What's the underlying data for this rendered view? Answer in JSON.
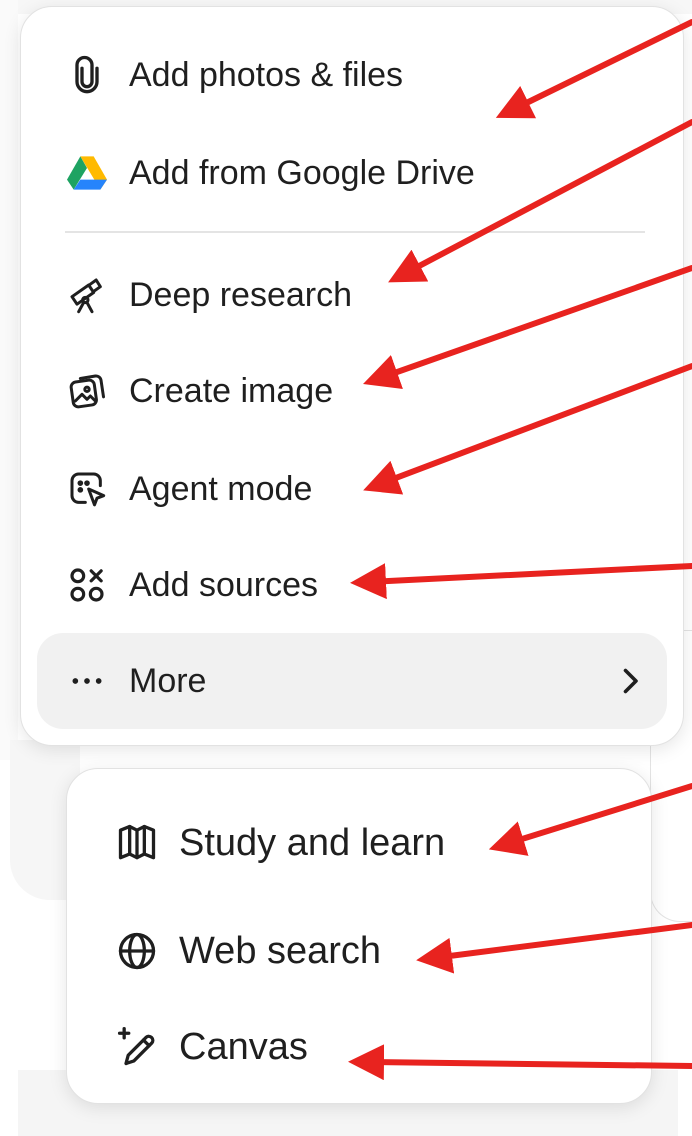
{
  "menu": {
    "items": [
      {
        "label": "Add photos & files",
        "icon": "paperclip-icon"
      },
      {
        "label": "Add from Google Drive",
        "icon": "google-drive-icon"
      },
      {
        "label": "Deep research",
        "icon": "telescope-icon"
      },
      {
        "label": "Create image",
        "icon": "image-icon"
      },
      {
        "label": "Agent mode",
        "icon": "agent-cursor-icon"
      },
      {
        "label": "Add sources",
        "icon": "sources-icon"
      }
    ],
    "more_label": "More",
    "more_icon": "ellipsis-icon"
  },
  "submenu": {
    "items": [
      {
        "label": "Study and learn",
        "icon": "book-icon"
      },
      {
        "label": "Web search",
        "icon": "globe-icon"
      },
      {
        "label": "Canvas",
        "icon": "pen-sparkle-icon"
      }
    ]
  },
  "colors": {
    "arrow": "#e8231f",
    "text": "#1f1f1f",
    "hover": "#f1f1f1",
    "drive_green": "#1ea362",
    "drive_yellow": "#ffba00",
    "drive_blue": "#2684fc"
  }
}
